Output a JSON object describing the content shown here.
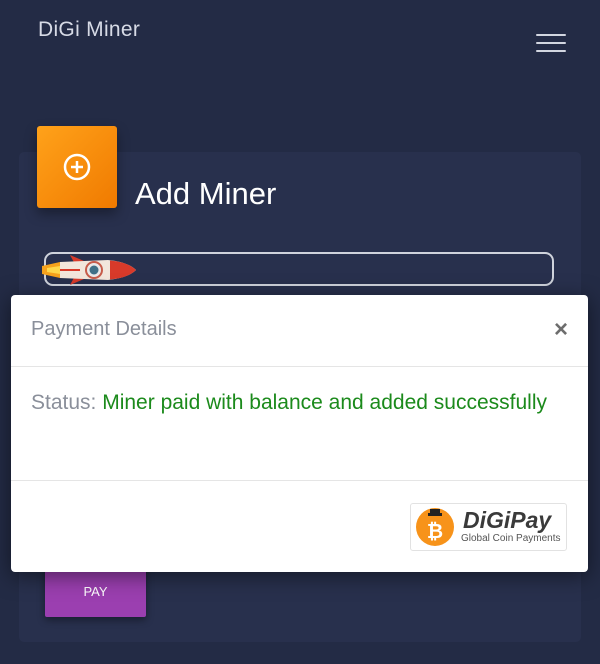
{
  "app": {
    "title": "DiGi Miner"
  },
  "nav": {
    "menu_icon": "hamburger-menu-icon"
  },
  "card": {
    "title": "Add Miner",
    "icon": "plus-circle-icon",
    "accent_color": "#f7890c",
    "rocket_icon": "rocket-icon"
  },
  "pay_button": {
    "label": "PAY",
    "color": "#9b3fb0"
  },
  "modal": {
    "title": "Payment Details",
    "close_label": "×",
    "status_label": "Status:",
    "status_text": "Miner paid with balance and added successfully",
    "status_color": "#1b8a1b"
  },
  "digipay": {
    "name": "DiGiPay",
    "tagline": "Global Coin Payments",
    "icon": "bitcoin-coin-icon"
  }
}
